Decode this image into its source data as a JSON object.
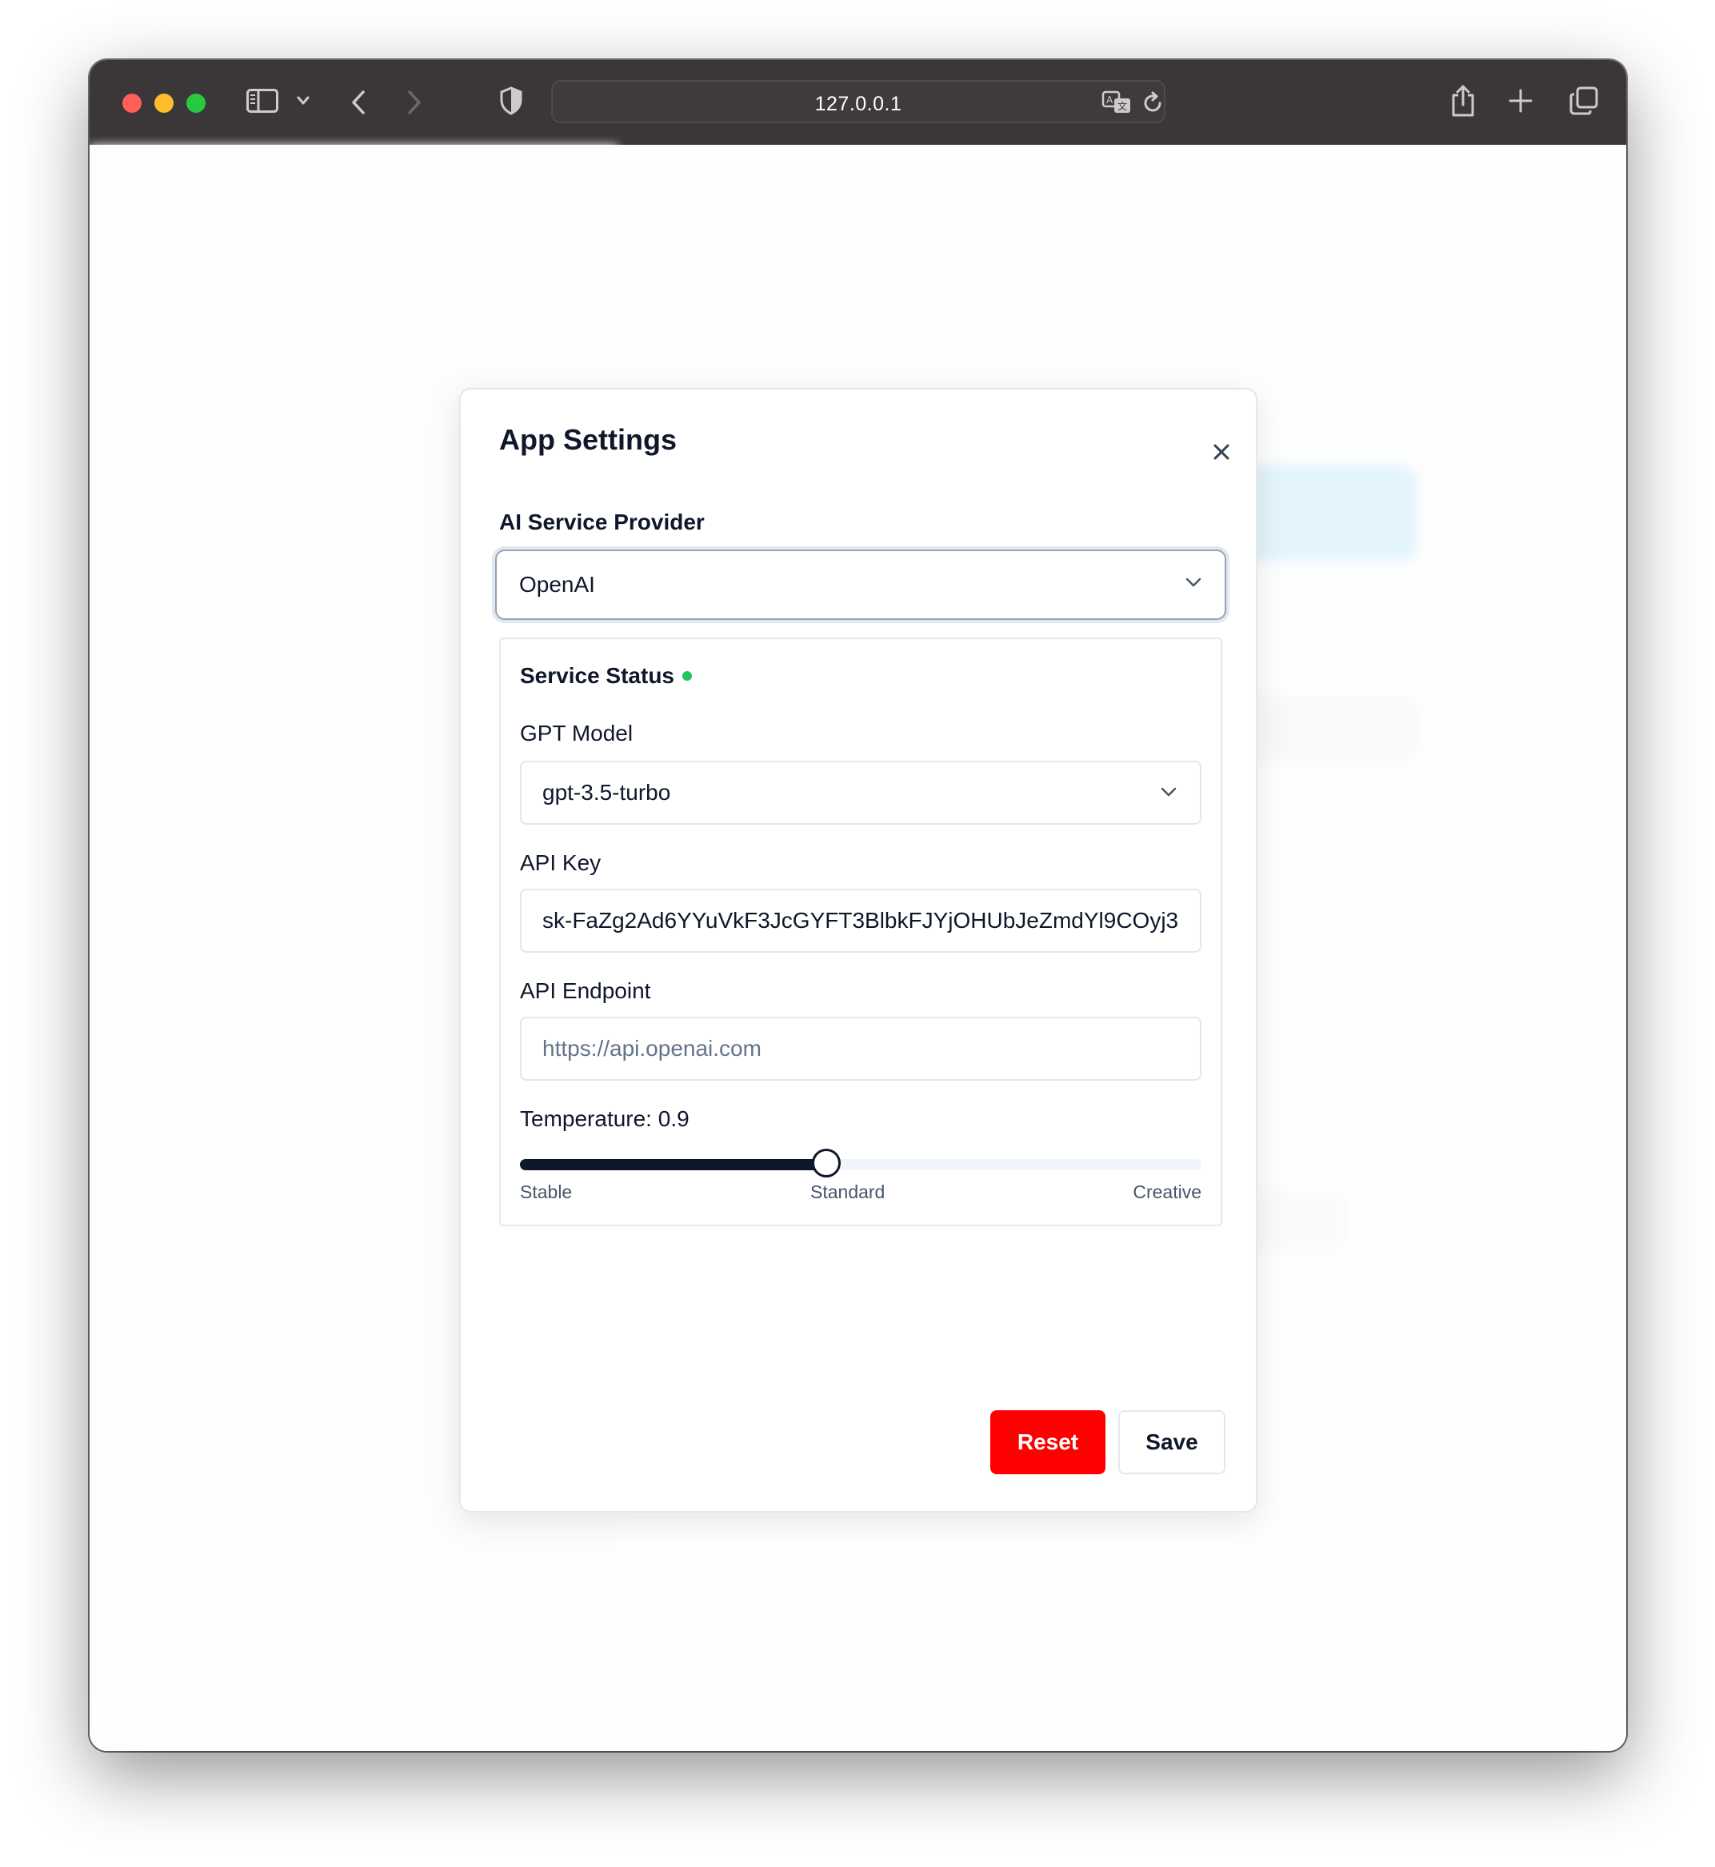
{
  "browser": {
    "url": "127.0.0.1"
  },
  "modal": {
    "title": "App Settings",
    "provider_label": "AI Service Provider",
    "provider_value": "OpenAI",
    "status_label": "Service Status",
    "status_color": "#22c55e",
    "model_label": "GPT Model",
    "model_value": "gpt-3.5-turbo",
    "api_key_label": "API Key",
    "api_key_value": "sk-FaZg2Ad6YYuVkF3JcGYFT3BlbkFJYjOHUbJeZmdYl9COyj3",
    "endpoint_label": "API Endpoint",
    "endpoint_placeholder": "https://api.openai.com",
    "temperature_label": "Temperature: 0.9",
    "temperature_value": 0.9,
    "temperature_fraction": 0.45,
    "tick_stable": "Stable",
    "tick_standard": "Standard",
    "tick_creative": "Creative",
    "reset_label": "Reset",
    "save_label": "Save",
    "reset_color": "#ff0000"
  }
}
